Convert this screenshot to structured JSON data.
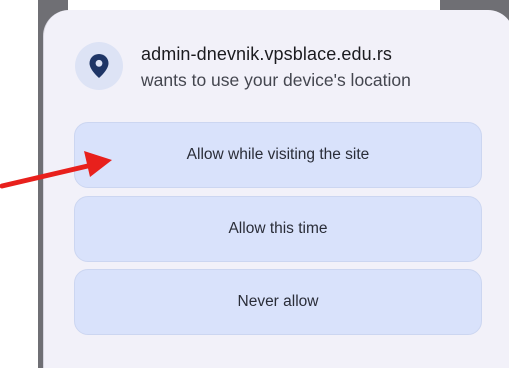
{
  "permission_dialog": {
    "site": "admin-dnevnik.vpsblace.edu.rs",
    "message": "wants to use your device's location",
    "icon": "location-pin-icon",
    "options": [
      {
        "label": "Allow while visiting the site"
      },
      {
        "label": "Allow this time"
      },
      {
        "label": "Never allow"
      }
    ]
  },
  "annotation": {
    "arrow_color": "#e8201c",
    "points_to": "Allow while visiting the site"
  },
  "colors": {
    "dialog_bg": "#f2f1f9",
    "option_bg": "#d9e2fb",
    "icon_bg": "#dde3f5",
    "icon_color": "#1e3566"
  }
}
